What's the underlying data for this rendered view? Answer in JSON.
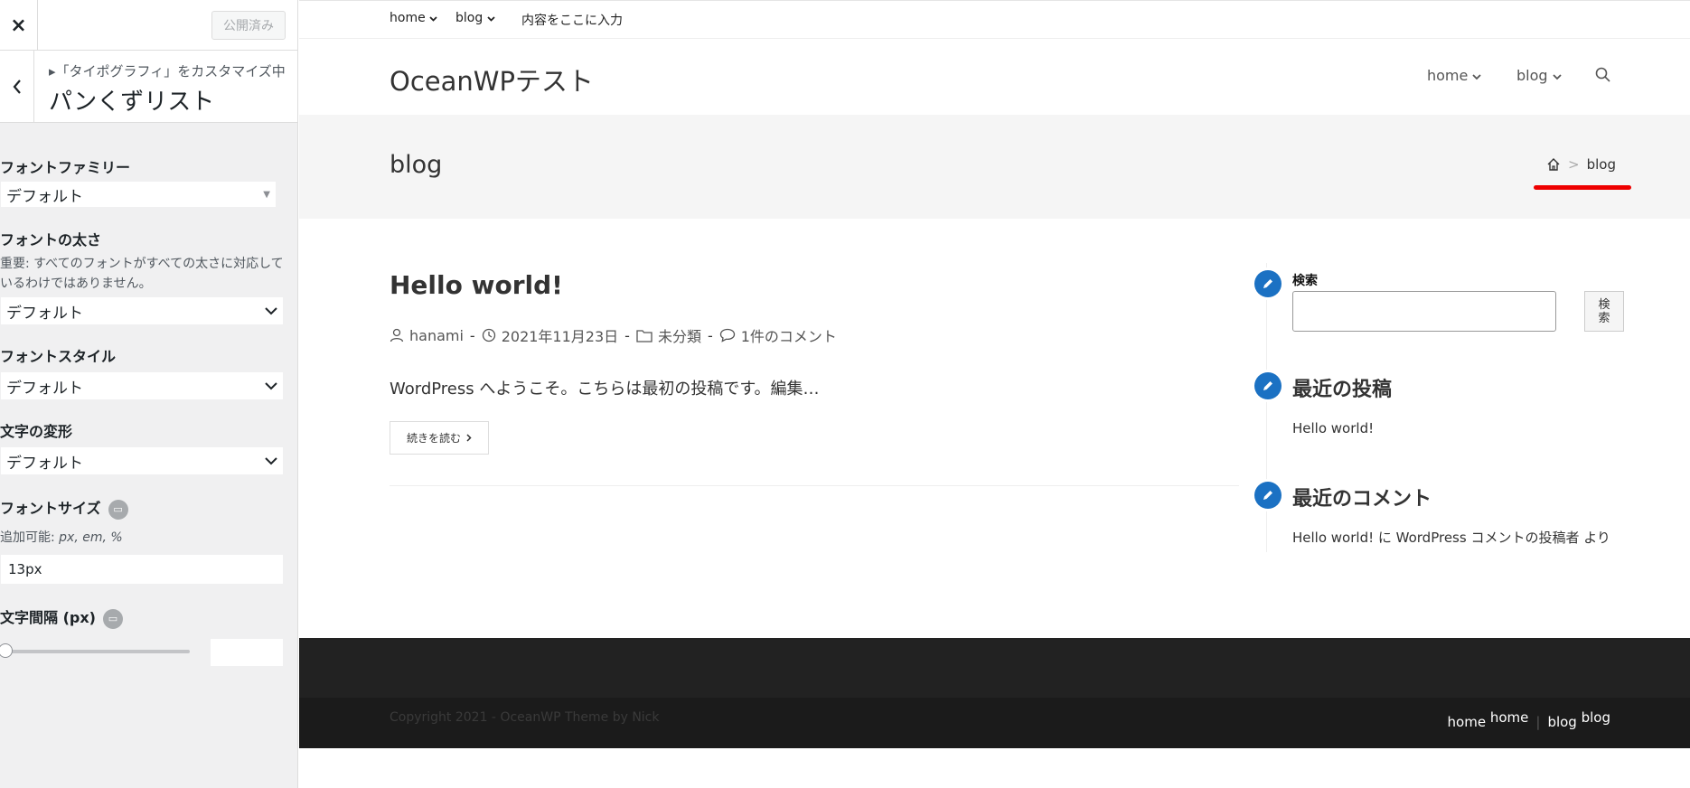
{
  "customizer": {
    "close_icon": "×",
    "publish_label": "公開済み",
    "back_icon": "‹",
    "breadcrumb": "▸「タイポグラフィ」をカスタマイズ中",
    "section_title": "パンくずリスト",
    "font_family": {
      "label": "フォントファミリー",
      "value": "デフォルト"
    },
    "font_weight": {
      "label": "フォントの太さ",
      "note": "重要: すべてのフォントがすべての太さに対応しているわけではありません。",
      "value": "デフォルト"
    },
    "font_style": {
      "label": "フォントスタイル",
      "value": "デフォルト"
    },
    "text_transform": {
      "label": "文字の変形",
      "value": "デフォルト"
    },
    "font_size": {
      "label": "フォントサイズ",
      "note_prefix": "追加可能: ",
      "note_units": "px, em, %",
      "value": "13px"
    },
    "letter_spacing": {
      "label": "文字間隔 (px)",
      "value": 0
    }
  },
  "site": {
    "topbar": [
      "home",
      "blog",
      "内容をここに入力"
    ],
    "title": "OceanWPテスト",
    "nav": [
      "home",
      "blog"
    ],
    "icons": {
      "search": "search-icon",
      "home": "home-icon"
    },
    "accent": "#1b71c3",
    "underline_color": "#e00000"
  },
  "page_header": {
    "title": "blog",
    "breadcrumb_sep": ">",
    "breadcrumb_current": "blog"
  },
  "post": {
    "title": "Hello world!",
    "author": "hanami",
    "date": "2021年11月23日",
    "category": "未分類",
    "comments": "1件のコメント",
    "meta_sep": "-",
    "excerpt": "WordPress へようこそ。こちらは最初の投稿です。編集…",
    "read_more": "続きを読む"
  },
  "sidebar": {
    "search_label": "検索",
    "search_button": "検索",
    "recent_posts_title": "最近の投稿",
    "recent_post": "Hello world!",
    "recent_comments_title": "最近のコメント",
    "recent_comment": "Hello world! に WordPress コメントの投稿者 より"
  },
  "footer": {
    "copyright": "Copyright 2021 - OceanWP Theme by Nick",
    "nav": [
      {
        "a": "home",
        "b": "home"
      },
      {
        "a": "blog",
        "b": "blog"
      }
    ],
    "sep": "|"
  }
}
